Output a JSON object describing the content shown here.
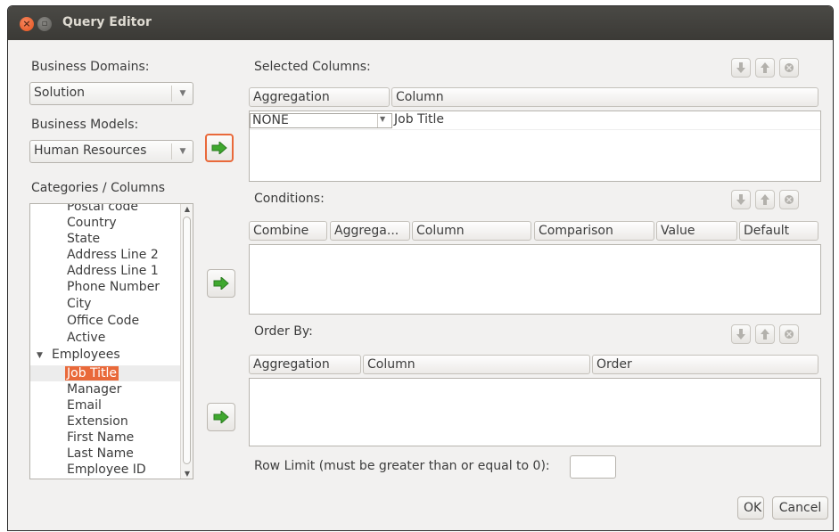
{
  "window": {
    "title": "Query Editor"
  },
  "left": {
    "business_domains_label": "Business Domains:",
    "business_domain_value": "Solution",
    "business_models_label": "Business Models:",
    "business_model_value": "Human Resources",
    "categories_label": "Categories / Columns",
    "tree_items": [
      {
        "label": "Postal code",
        "level": 1
      },
      {
        "label": "Country",
        "level": 1
      },
      {
        "label": "State",
        "level": 1
      },
      {
        "label": "Address Line 2",
        "level": 1
      },
      {
        "label": "Address Line 1",
        "level": 1
      },
      {
        "label": "Phone Number",
        "level": 1
      },
      {
        "label": "City",
        "level": 1
      },
      {
        "label": "Office Code",
        "level": 1
      },
      {
        "label": "Active",
        "level": 1
      },
      {
        "label": "Employees",
        "level": 0,
        "expanded": true
      },
      {
        "label": "Job Title",
        "level": 1,
        "selected": true
      },
      {
        "label": "Manager",
        "level": 1
      },
      {
        "label": "Email",
        "level": 1
      },
      {
        "label": "Extension",
        "level": 1
      },
      {
        "label": "First Name",
        "level": 1
      },
      {
        "label": "Last Name",
        "level": 1
      },
      {
        "label": "Employee ID",
        "level": 1
      }
    ]
  },
  "selected_columns": {
    "label": "Selected Columns:",
    "headers": [
      "Aggregation",
      "Column"
    ],
    "rows": [
      {
        "aggregation": "NONE",
        "column": "Job Title"
      }
    ]
  },
  "conditions": {
    "label": "Conditions:",
    "headers": [
      "Combine",
      "Aggrega...",
      "Column",
      "Comparison",
      "Value",
      "Default"
    ]
  },
  "order_by": {
    "label": "Order By:",
    "headers": [
      "Aggregation",
      "Column",
      "Order"
    ]
  },
  "row_limit": {
    "label": "Row Limit (must be greater than or equal to 0):",
    "value": ""
  },
  "buttons": {
    "ok": "OK",
    "cancel": "Cancel"
  },
  "icons": {
    "add_arrow": "green-right-arrow-icon",
    "move_down": "move-down-icon",
    "move_up": "move-up-icon",
    "remove": "remove-icon"
  },
  "colors": {
    "selection": "#e9693a",
    "arrow_green": "#3fa82e",
    "titlebar": "#3c3b37"
  }
}
